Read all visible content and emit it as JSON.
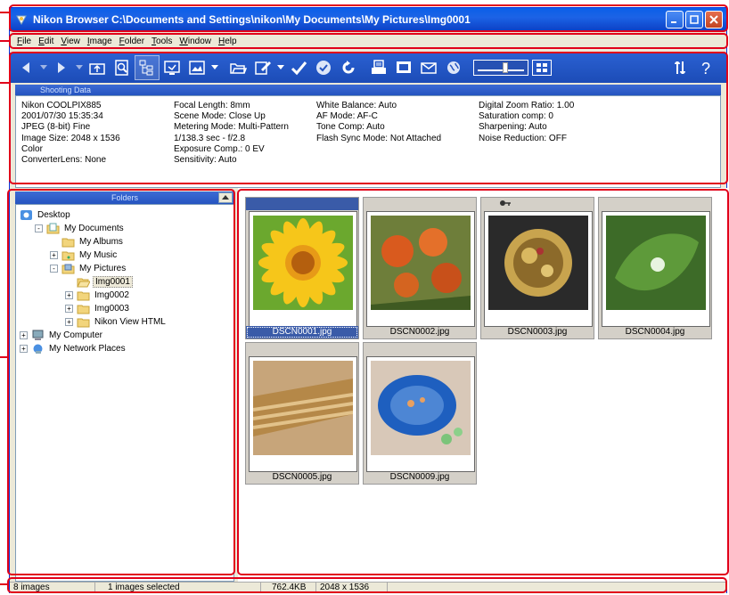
{
  "window": {
    "title": "Nikon Browser C:\\Documents and Settings\\nikon\\My Documents\\My Pictures\\Img0001"
  },
  "menu": [
    "File",
    "Edit",
    "View",
    "Image",
    "Folder",
    "Tools",
    "Window",
    "Help"
  ],
  "toolbar": {
    "icons": [
      "back-arrow-icon",
      "forward-arrow-icon",
      "up-folder-icon",
      "magnify-icon",
      "folder-tree-icon",
      "view-mode-icon",
      "thumbnail-view-icon",
      "open-folder-icon",
      "edit-icon",
      "check-icon",
      "protect-icon",
      "rotate-icon",
      "print-icon",
      "slideshow-icon",
      "mail-icon",
      "web-icon",
      "thumbnail-size-slider",
      "thumbnail-grid-icon",
      "settings-icon",
      "help-icon"
    ]
  },
  "shooting_data": {
    "header": "Shooting Data",
    "col1": [
      "Nikon COOLPIX885",
      "2001/07/30 15:35:34",
      "JPEG (8-bit) Fine",
      "Image Size:  2048 x 1536",
      "Color",
      "ConverterLens: None"
    ],
    "col2": [
      "Focal Length: 8mm",
      "Scene Mode: Close Up",
      "Metering Mode: Multi-Pattern",
      "1/138.3 sec - f/2.8",
      "Exposure Comp.: 0 EV",
      "Sensitivity: Auto"
    ],
    "col3": [
      "White Balance: Auto",
      "AF Mode: AF-C",
      "Tone Comp: Auto",
      "Flash Sync Mode: Not Attached"
    ],
    "col4": [
      "Digital Zoom Ratio: 1.00",
      "Saturation comp: 0",
      "Sharpening: Auto",
      "Noise Reduction: OFF"
    ]
  },
  "folders": {
    "header": "Folders",
    "tree": [
      {
        "label": "Desktop",
        "icon": "desktop-icon",
        "indent": 0,
        "expander": ""
      },
      {
        "label": "My Documents",
        "icon": "my-documents-icon",
        "indent": 1,
        "expander": "-"
      },
      {
        "label": "My Albums",
        "icon": "folder-icon",
        "indent": 2,
        "expander": ""
      },
      {
        "label": "My Music",
        "icon": "music-folder-icon",
        "indent": 2,
        "expander": "+"
      },
      {
        "label": "My Pictures",
        "icon": "pictures-folder-icon",
        "indent": 2,
        "expander": "-"
      },
      {
        "label": "Img0001",
        "icon": "open-folder-icon",
        "indent": 3,
        "expander": "",
        "selected": true
      },
      {
        "label": "Img0002",
        "icon": "folder-icon",
        "indent": 3,
        "expander": "+"
      },
      {
        "label": "Img0003",
        "icon": "folder-icon",
        "indent": 3,
        "expander": "+"
      },
      {
        "label": "Nikon View HTML",
        "icon": "folder-icon",
        "indent": 3,
        "expander": "+"
      },
      {
        "label": "My Computer",
        "icon": "computer-icon",
        "indent": 0,
        "expander": "+"
      },
      {
        "label": "My Network Places",
        "icon": "network-icon",
        "indent": 0,
        "expander": "+"
      }
    ]
  },
  "thumbnails": [
    {
      "name": "DSCN0001.jpg",
      "subject": "sunflower",
      "selected": true,
      "protected": false
    },
    {
      "name": "DSCN0002.jpg",
      "subject": "lilies",
      "selected": false,
      "protected": false
    },
    {
      "name": "DSCN0003.jpg",
      "subject": "pocket-watch",
      "selected": false,
      "protected": true
    },
    {
      "name": "DSCN0004.jpg",
      "subject": "leaf-droplet",
      "selected": false,
      "protected": false
    },
    {
      "name": "DSCN0005.jpg",
      "subject": "wheat",
      "selected": false,
      "protected": false
    },
    {
      "name": "DSCN0009.jpg",
      "subject": "blue-bowl-beads",
      "selected": false,
      "protected": false
    }
  ],
  "status": {
    "count": "8 images",
    "selected": "1 images selected",
    "size": "762.4KB",
    "dimensions": "2048 x 1536"
  },
  "colors": {
    "accent": "#1C4CB7",
    "callout": "#E1001A",
    "selection": "#3A5BA8"
  }
}
